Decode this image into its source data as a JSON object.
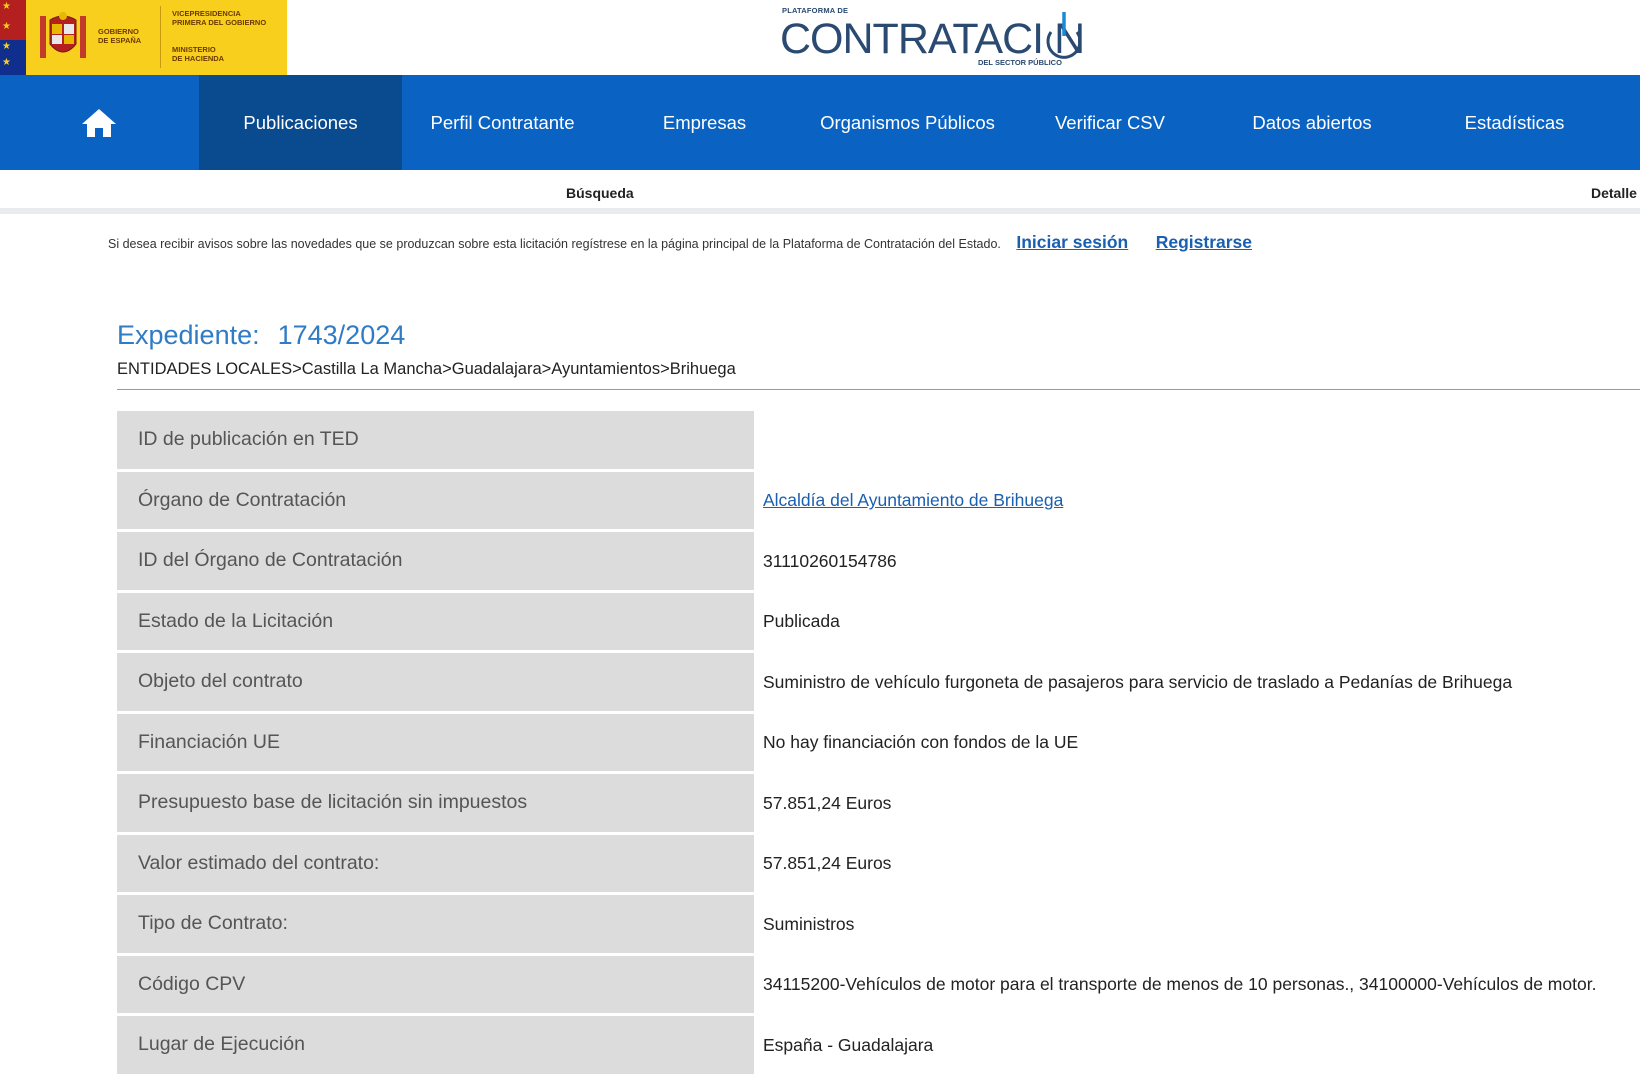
{
  "header": {
    "gov_line1": "Gobierno",
    "gov_line2": "de España",
    "vice_line1": "Vicepresidencia",
    "vice_line2": "Primera del Gobierno",
    "min_line1": "Ministerio",
    "min_line2": "de Hacienda",
    "brand_top": "PLATAFORMA DE",
    "brand_main": "CONTRATACI N",
    "brand_sub": "DEL SECTOR PÚBLICO"
  },
  "nav": {
    "items": [
      {
        "label": "Publicaciones",
        "active": true
      },
      {
        "label": "Perfil Contratante"
      },
      {
        "label": "Empresas"
      },
      {
        "label": "Organismos Públicos"
      },
      {
        "label": "Verificar CSV"
      },
      {
        "label": "Datos abiertos"
      },
      {
        "label": "Estadísticas"
      }
    ]
  },
  "subnav": {
    "search": "Búsqueda",
    "detail": "Detalle"
  },
  "notice": {
    "text": "Si desea recibir avisos sobre las novedades que se produzcan sobre esta licitación regístrese en la página principal de la Plataforma de Contratación del Estado.",
    "login": "Iniciar sesión",
    "register": "Registrarse"
  },
  "expediente": {
    "label": "Expediente:",
    "number": "1743/2024",
    "breadcrumb": "ENTIDADES LOCALES>Castilla La Mancha>Guadalajara>Ayuntamientos>Brihuega"
  },
  "rows": [
    {
      "label": "ID de publicación en TED",
      "value": ""
    },
    {
      "label": "Órgano de Contratación",
      "value": "Alcaldía del Ayuntamiento de Brihuega"
    },
    {
      "label": "ID del Órgano de Contratación",
      "value": "31110260154786"
    },
    {
      "label": "Estado de la Licitación",
      "value": "Publicada"
    },
    {
      "label": "Objeto del contrato",
      "value": "Suministro de vehículo furgoneta de pasajeros para servicio de traslado a Pedanías de Brihuega"
    },
    {
      "label": "Financiación UE",
      "value": "No hay financiación con fondos de la UE"
    },
    {
      "label": "Presupuesto base de licitación sin impuestos",
      "value": "57.851,24 Euros"
    },
    {
      "label": "Valor estimado del contrato:",
      "value": "57.851,24 Euros"
    },
    {
      "label": "Tipo de Contrato:",
      "value": "Suministros"
    },
    {
      "label": "Código CPV",
      "value": "34115200-Vehículos de motor para el transporte de menos de 10 personas., 34100000-Vehículos de motor."
    },
    {
      "label": "Lugar de Ejecución",
      "value": "España - Guadalajara"
    }
  ],
  "colors": {
    "nav_bg": "#0a63c2",
    "nav_active": "#0a4a8e",
    "title_blue": "#2f7bc6",
    "link_blue": "#1a5fb0",
    "label_bg": "#dcdcdc"
  }
}
